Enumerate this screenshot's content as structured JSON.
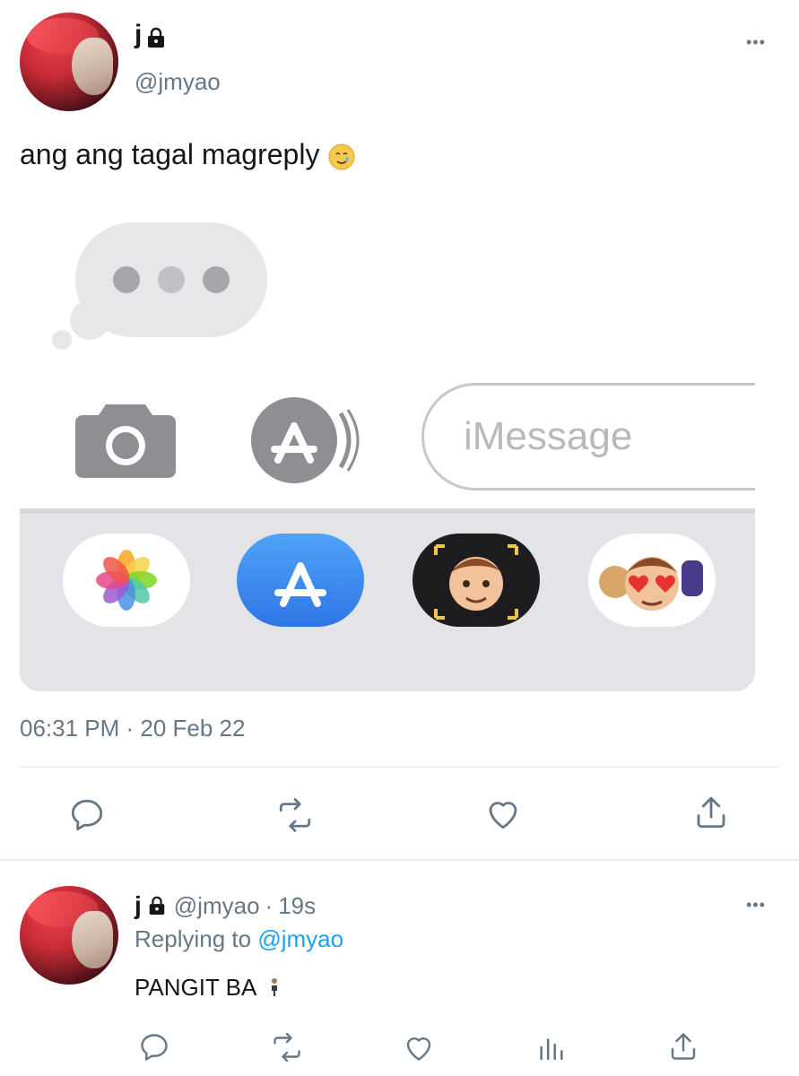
{
  "tweet": {
    "author_name": "j",
    "handle": "@jmyao",
    "text": "ang ang tagal magreply",
    "timestamp": "06:31 PM · 20 Feb 22",
    "more_glyph": "•••"
  },
  "image": {
    "input_placeholder": "iMessage"
  },
  "reply": {
    "author_name": "j",
    "handle": "@jmyao",
    "separator": "·",
    "age": "19s",
    "replying_to_prefix": "Replying to",
    "replying_to_handle": "@jmyao",
    "text": "PANGIT BA",
    "more_glyph": "•••"
  },
  "icons": {
    "lock": "lock-icon",
    "crying_face": "smiling-face-with-tear-icon",
    "reply": "reply-icon",
    "retweet": "retweet-icon",
    "like": "heart-icon",
    "share": "share-icon",
    "analytics": "analytics-icon",
    "more": "more-icon"
  },
  "colors": {
    "link": "#1da1f2",
    "secondary_text": "#657786",
    "primary_text": "#14171a",
    "appstore_blue": "#3a8af0"
  }
}
